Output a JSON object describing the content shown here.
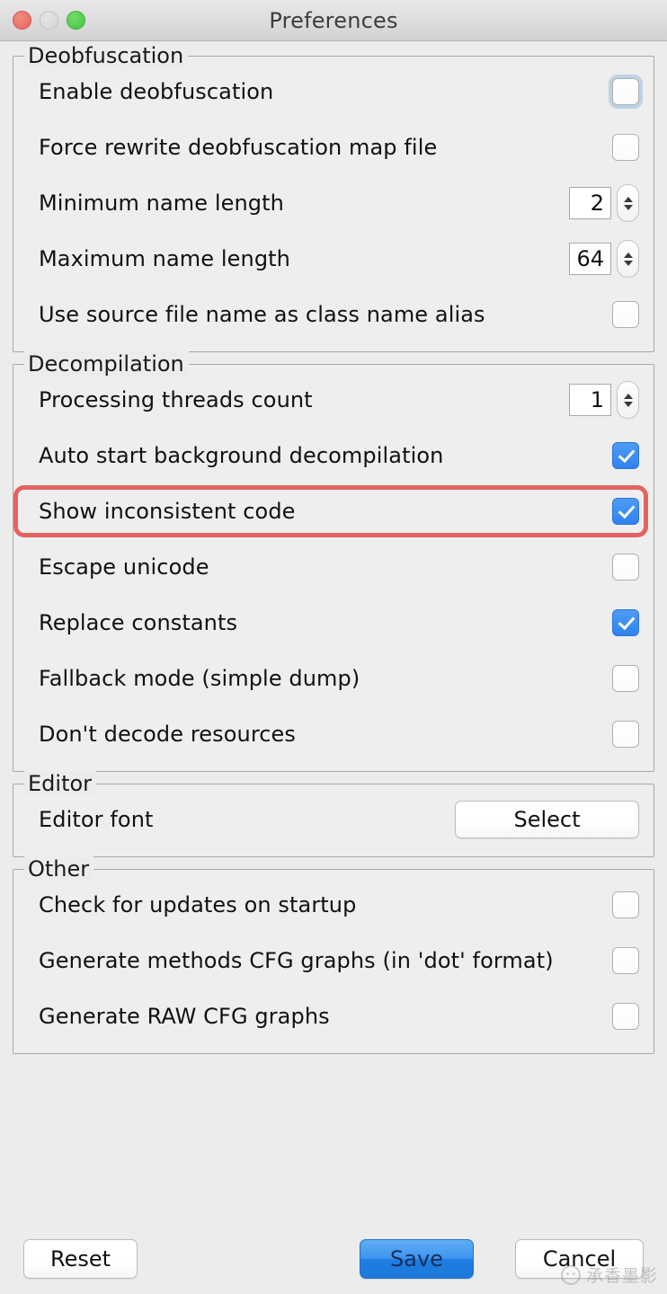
{
  "window": {
    "title": "Preferences",
    "traffic_lights": [
      {
        "name": "close",
        "color": "#e8665a"
      },
      {
        "name": "minimize",
        "color": "#d6d6d6"
      },
      {
        "name": "maximize",
        "color": "#44c63e"
      }
    ]
  },
  "groups": [
    {
      "id": "deobfuscation",
      "title": "Deobfuscation",
      "rows": [
        {
          "id": "enable-deobfuscation",
          "label": "Enable deobfuscation",
          "control": "checkbox",
          "checked": false,
          "focused": true
        },
        {
          "id": "force-rewrite-map",
          "label": "Force rewrite deobfuscation map file",
          "control": "checkbox",
          "checked": false,
          "focused": false
        },
        {
          "id": "min-name-length",
          "label": "Minimum name length",
          "control": "spinner",
          "value": "2"
        },
        {
          "id": "max-name-length",
          "label": "Maximum name length",
          "control": "spinner",
          "value": "64"
        },
        {
          "id": "source-file-alias",
          "label": "Use source file name as class name alias",
          "control": "checkbox",
          "checked": false,
          "focused": false
        }
      ]
    },
    {
      "id": "decompilation",
      "title": "Decompilation",
      "rows": [
        {
          "id": "threads-count",
          "label": "Processing threads count",
          "control": "spinner",
          "value": "1"
        },
        {
          "id": "auto-start-background",
          "label": "Auto start background decompilation",
          "control": "checkbox",
          "checked": true,
          "focused": false
        },
        {
          "id": "show-inconsistent-code",
          "label": "Show inconsistent code",
          "control": "checkbox",
          "checked": true,
          "focused": false,
          "highlighted": true
        },
        {
          "id": "escape-unicode",
          "label": "Escape unicode",
          "control": "checkbox",
          "checked": false,
          "focused": false
        },
        {
          "id": "replace-constants",
          "label": "Replace constants",
          "control": "checkbox",
          "checked": true,
          "focused": false
        },
        {
          "id": "fallback-mode",
          "label": "Fallback mode (simple dump)",
          "control": "checkbox",
          "checked": false,
          "focused": false
        },
        {
          "id": "dont-decode-resources",
          "label": "Don't decode resources",
          "control": "checkbox",
          "checked": false,
          "focused": false
        }
      ]
    },
    {
      "id": "editor",
      "title": "Editor",
      "rows": [
        {
          "id": "editor-font",
          "label": "Editor font",
          "control": "button",
          "button_label": "Select"
        }
      ]
    },
    {
      "id": "other",
      "title": "Other",
      "rows": [
        {
          "id": "check-updates",
          "label": "Check for updates on startup",
          "control": "checkbox",
          "checked": false,
          "focused": false
        },
        {
          "id": "generate-cfg-dot",
          "label": "Generate methods CFG graphs (in 'dot' format)",
          "control": "checkbox",
          "checked": false,
          "focused": false
        },
        {
          "id": "generate-raw-cfg",
          "label": "Generate RAW CFG graphs",
          "control": "checkbox",
          "checked": false,
          "focused": false
        }
      ]
    }
  ],
  "footer": {
    "reset_label": "Reset",
    "save_label": "Save",
    "cancel_label": "Cancel"
  },
  "watermark": {
    "text": "承香墨影"
  },
  "colors": {
    "accent_blue": "#2f83ee",
    "annotation_red": "#e2635f",
    "window_bg": "#ececec",
    "group_bg": "#eeeeee"
  }
}
